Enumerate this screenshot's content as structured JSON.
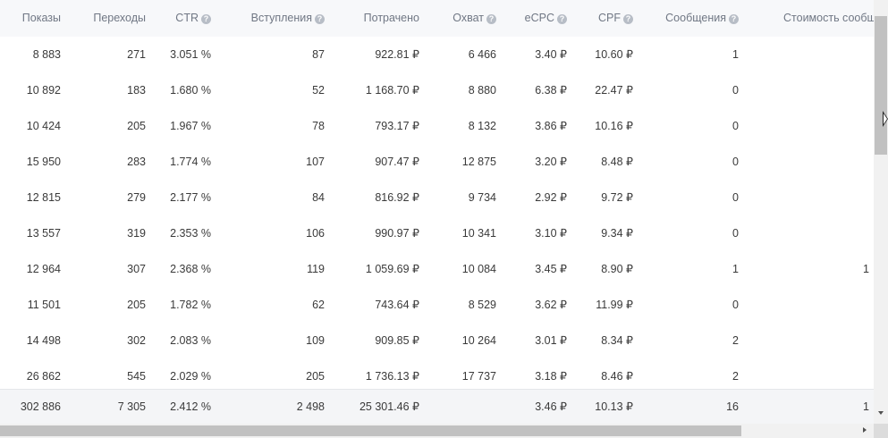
{
  "table": {
    "columns": [
      {
        "label": "Показы",
        "help": false
      },
      {
        "label": "Переходы",
        "help": false
      },
      {
        "label": "CTR",
        "help": true
      },
      {
        "label": "Вступления",
        "help": true
      },
      {
        "label": "Потрачено",
        "help": false
      },
      {
        "label": "Охват",
        "help": true
      },
      {
        "label": "eCPC",
        "help": true
      },
      {
        "label": "CPF",
        "help": true
      },
      {
        "label": "Сообщения",
        "help": true
      },
      {
        "label": "Стоимость сообщения",
        "help": false
      }
    ],
    "help_glyph": "?",
    "rows": [
      [
        "8 883",
        "271",
        "3.051 %",
        "87",
        "922.81 ₽",
        "6 466",
        "3.40 ₽",
        "10.60 ₽",
        "1",
        ""
      ],
      [
        "10 892",
        "183",
        "1.680 %",
        "52",
        "1 168.70 ₽",
        "8 880",
        "6.38 ₽",
        "22.47 ₽",
        "0",
        ""
      ],
      [
        "10 424",
        "205",
        "1.967 %",
        "78",
        "793.17 ₽",
        "8 132",
        "3.86 ₽",
        "10.16 ₽",
        "0",
        ""
      ],
      [
        "15 950",
        "283",
        "1.774 %",
        "107",
        "907.47 ₽",
        "12 875",
        "3.20 ₽",
        "8.48 ₽",
        "0",
        ""
      ],
      [
        "12 815",
        "279",
        "2.177 %",
        "84",
        "816.92 ₽",
        "9 734",
        "2.92 ₽",
        "9.72 ₽",
        "0",
        ""
      ],
      [
        "13 557",
        "319",
        "2.353 %",
        "106",
        "990.97 ₽",
        "10 341",
        "3.10 ₽",
        "9.34 ₽",
        "0",
        ""
      ],
      [
        "12 964",
        "307",
        "2.368 %",
        "119",
        "1 059.69 ₽",
        "10 084",
        "3.45 ₽",
        "8.90 ₽",
        "1",
        "1"
      ],
      [
        "11 501",
        "205",
        "1.782 %",
        "62",
        "743.64 ₽",
        "8 529",
        "3.62 ₽",
        "11.99 ₽",
        "0",
        ""
      ],
      [
        "14 498",
        "302",
        "2.083 %",
        "109",
        "909.85 ₽",
        "10 264",
        "3.01 ₽",
        "8.34 ₽",
        "2",
        ""
      ],
      [
        "26 862",
        "545",
        "2.029 %",
        "205",
        "1 736.13 ₽",
        "17 737",
        "3.18 ₽",
        "8.46 ₽",
        "2",
        ""
      ]
    ],
    "totals": [
      "302 886",
      "7 305",
      "2.412 %",
      "2 498",
      "25 301.46 ₽",
      "",
      "3.46 ₽",
      "10.13 ₽",
      "16",
      "1"
    ]
  }
}
